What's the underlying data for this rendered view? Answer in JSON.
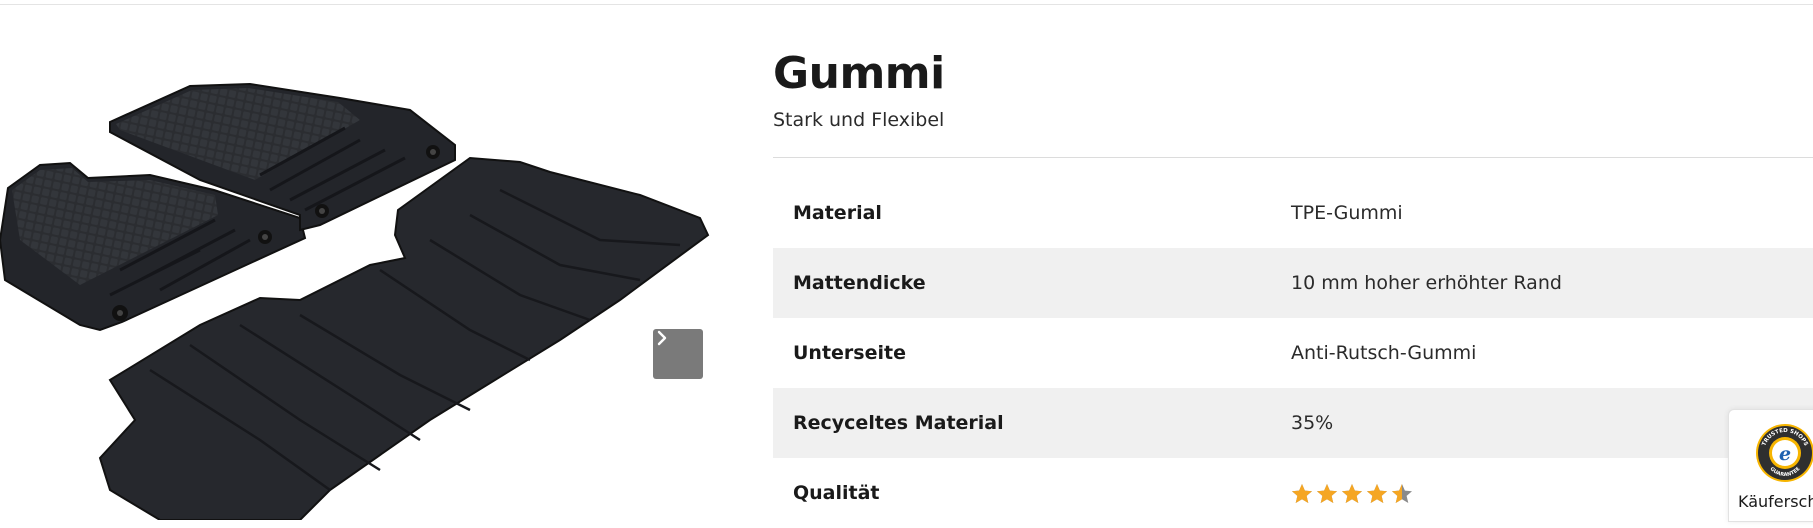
{
  "product": {
    "title": "Gummi",
    "subtitle": "Stark und Flexibel"
  },
  "gallery": {
    "next_icon": "chevron-right-icon",
    "next_button_color": "#7a7a7a"
  },
  "specs": [
    {
      "label": "Material",
      "value": "TPE-Gummi"
    },
    {
      "label": "Mattendicke",
      "value": "10 mm hoher erhöhter Rand"
    },
    {
      "label": "Unterseite",
      "value": "Anti-Rutsch-Gummi"
    },
    {
      "label": "Recyceltes Material",
      "value": "35%"
    },
    {
      "label": "Qualität",
      "rating": 4.5,
      "rating_max": 5
    }
  ],
  "trust_badge": {
    "seal_text": "TRUSTED SHOPS",
    "seal_subtext": "GUARANTEE",
    "label": "Käufersch"
  },
  "colors": {
    "star": "#f5a623",
    "star_empty": "#8a8a8a",
    "row_alt": "#f0f0f0"
  }
}
